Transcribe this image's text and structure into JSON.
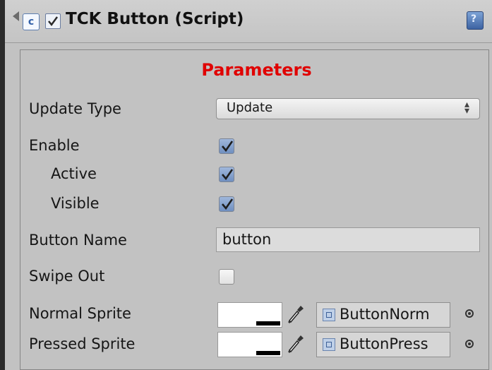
{
  "component": {
    "title": "TCK Button (Script)",
    "enabled": true
  },
  "section": {
    "title": "Parameters",
    "title_color": "#e00000"
  },
  "fields": {
    "update_type": {
      "label": "Update Type",
      "value": "Update"
    },
    "enable": {
      "label": "Enable",
      "checked": true
    },
    "active": {
      "label": "Active",
      "checked": true
    },
    "visible": {
      "label": "Visible",
      "checked": true
    },
    "button_name": {
      "label": "Button Name",
      "value": "button"
    },
    "swipe_out": {
      "label": "Swipe Out",
      "checked": false
    },
    "normal_sprite": {
      "label": "Normal Sprite",
      "value": "ButtonNorm"
    },
    "pressed_sprite": {
      "label": "Pressed Sprite",
      "value": "ButtonPress"
    }
  },
  "icons": {
    "script": "csharp-script-icon",
    "help": "help-book-icon",
    "picker": "eyedropper-icon",
    "object_picker": "object-picker-target-icon",
    "sprite": "sprite-asset-icon"
  }
}
